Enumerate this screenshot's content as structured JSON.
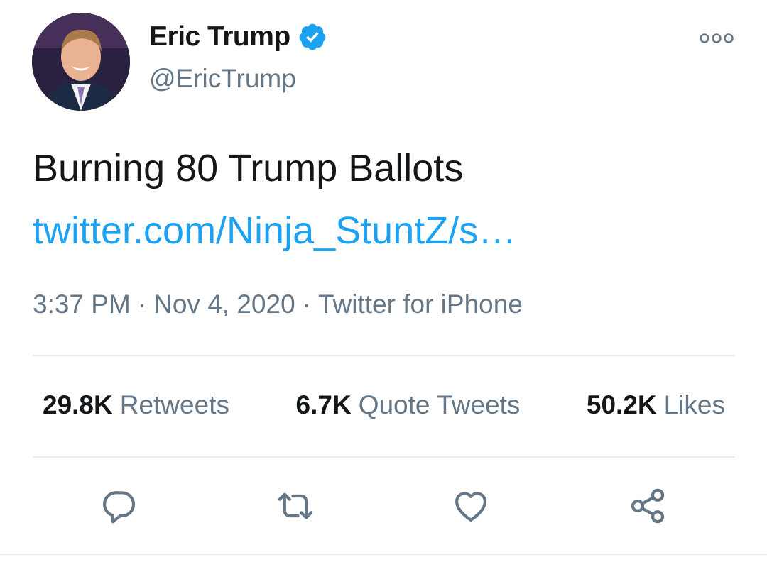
{
  "profile": {
    "name": "Eric Trump",
    "handle": "@EricTrump",
    "verified_icon": "verified-badge-icon"
  },
  "tweet": {
    "text": "Burning 80 Trump Ballots",
    "link": "twitter.com/Ninja_StuntZ/s…",
    "time": "3:37 PM",
    "date": "Nov 4, 2020",
    "separator": "·",
    "source": "Twitter for iPhone"
  },
  "stats": {
    "retweets_count": "29.8K",
    "retweets_label": "Retweets",
    "quotes_count": "6.7K",
    "quotes_label": "Quote Tweets",
    "likes_count": "50.2K",
    "likes_label": "Likes"
  },
  "actions": [
    "reply-icon",
    "retweet-icon",
    "like-icon",
    "share-icon"
  ],
  "colors": {
    "accent": "#1da1f2",
    "secondary_text": "#657786",
    "primary_text": "#14171a",
    "divider": "#e6ecf0"
  }
}
